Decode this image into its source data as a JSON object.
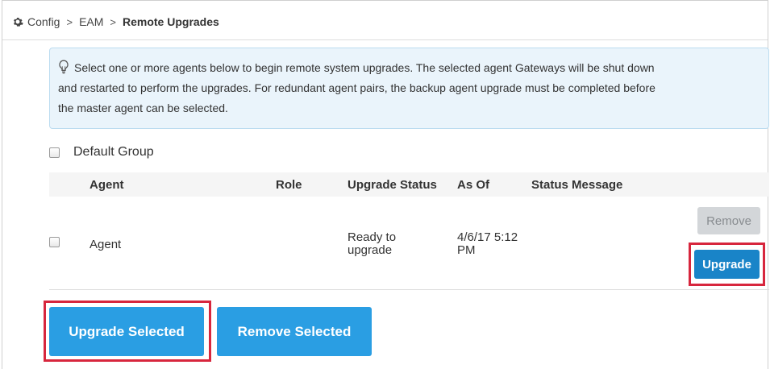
{
  "breadcrumb": {
    "items": [
      "Config",
      "EAM"
    ],
    "current": "Remote Upgrades",
    "separator": ">"
  },
  "info": {
    "icon": "lightbulb-icon",
    "line1": "Select one or more agents below to begin remote system upgrades. The selected agent Gateways will be shut down",
    "line2": "and restarted to perform the upgrades. For redundant agent pairs, the backup agent upgrade must be completed before",
    "line3": "the master agent can be selected."
  },
  "group": {
    "label": "Default Group",
    "checked": false
  },
  "table": {
    "headers": [
      "Agent",
      "Role",
      "Upgrade Status",
      "As Of",
      "Status Message"
    ],
    "rows": [
      {
        "agent": "Agent",
        "role": "",
        "status_line1": "Ready to",
        "status_line2": "upgrade",
        "asof_line1": "4/6/17 5:12",
        "asof_line2": "PM",
        "message": "",
        "remove_label": "Remove",
        "remove_disabled": true,
        "upgrade_label": "Upgrade"
      }
    ]
  },
  "actions": {
    "upgrade_selected_label": "Upgrade Selected",
    "remove_selected_label": "Remove Selected"
  },
  "colors": {
    "primary": "#2a9ee3",
    "primary_dark": "#1984c8",
    "highlight": "#d7263d",
    "info_bg": "#eaf4fb",
    "info_border": "#bcdcf0"
  }
}
